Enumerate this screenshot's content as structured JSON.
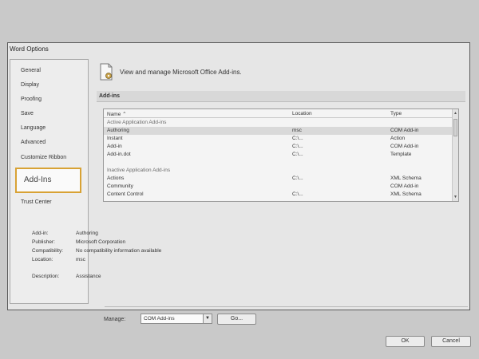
{
  "window": {
    "title": "Word Options"
  },
  "nav": {
    "items": [
      "General",
      "Display",
      "Proofing",
      "Save",
      "Language",
      "Advanced",
      "Customize Ribbon"
    ],
    "selected": "Add-Ins",
    "after": [
      "Trust Center"
    ]
  },
  "header": {
    "text": "View and manage Microsoft Office Add-ins."
  },
  "section": {
    "title": "Add-ins"
  },
  "list": {
    "columns": {
      "name": "Name ⌃",
      "location": "Location",
      "type": "Type"
    },
    "rows": [
      {
        "kind": "group",
        "name": "Active Application Add-ins",
        "location": "",
        "type": ""
      },
      {
        "kind": "item",
        "selected": true,
        "name": "Authoring",
        "location": "msc",
        "type": "COM Add-in"
      },
      {
        "kind": "item",
        "name": "Instant",
        "location": "C:\\...",
        "type": "Action"
      },
      {
        "kind": "item",
        "name": "Add-in",
        "location": "C:\\...",
        "type": "COM Add-in"
      },
      {
        "kind": "item",
        "name": "Add-in.dot",
        "location": "C:\\...",
        "type": "Template"
      },
      {
        "kind": "group",
        "name": "Inactive Application Add-ins",
        "location": "",
        "type": ""
      },
      {
        "kind": "item",
        "name": "Actions",
        "location": "C:\\...",
        "type": "XML Schema"
      },
      {
        "kind": "item",
        "name": "Community",
        "location": "",
        "type": "COM Add-in"
      },
      {
        "kind": "item",
        "name": "Content Control",
        "location": "C:\\...",
        "type": "XML Schema"
      }
    ]
  },
  "details": [
    {
      "key": "Add-in:",
      "value": "Authoring"
    },
    {
      "key": "Publisher:",
      "value": "Microsoft Corporation"
    },
    {
      "key": "Compatibility:",
      "value": "No compatibility information available"
    },
    {
      "key": "Location:",
      "value": "msc"
    },
    {
      "key": "",
      "value": ""
    },
    {
      "key": "Description:",
      "value": "Assistance"
    }
  ],
  "manage": {
    "label": "Manage:",
    "value": "COM Add-ins",
    "go_label": "Go..."
  },
  "buttons": {
    "ok": "OK",
    "cancel": "Cancel"
  },
  "colors": {
    "selection_highlight": "#d8a234"
  }
}
